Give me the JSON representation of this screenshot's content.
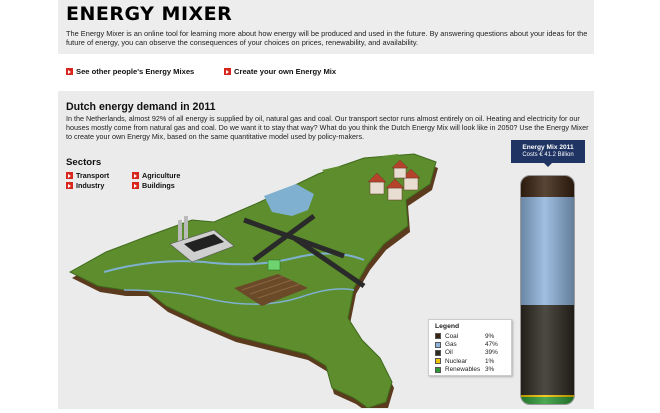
{
  "header": {
    "title": "ENERGY MIXER",
    "intro": "The Energy Mixer is an online tool for learning more about how energy will be produced and used in the future. By answering questions about your ideas for the future of energy, you can observe the consequences of your choices on prices, renewability, and availability."
  },
  "links": {
    "see_others": "See other people's Energy Mixes",
    "create_own": "Create your own Energy Mix"
  },
  "panel": {
    "heading": "Dutch energy demand in 2011",
    "description": "In the Netherlands, almost 92% of all energy is supplied by oil, natural gas and coal. Our transport sector runs almost entirely on oil. Heating and electricity for our houses mostly come from natural gas and coal. Do we want it to stay that way? What do you think the Dutch Energy Mix will look like in 2050? Use the Energy Mixer to create your own Energy Mix, based on the same quantitative model used by policy-makers."
  },
  "sectors": {
    "heading": "Sectors",
    "items": [
      "Transport",
      "Agriculture",
      "Industry",
      "Buildings"
    ]
  },
  "mix": {
    "title": "Energy Mix 2011",
    "cost": "Costs € 41.2 Billion"
  },
  "legend": {
    "title": "Legend",
    "items": [
      {
        "name": "Coal",
        "value": "9%",
        "fraction": 0.09,
        "color": "#3a2412"
      },
      {
        "name": "Gas",
        "value": "47%",
        "fraction": 0.47,
        "color": "#8fb4dc"
      },
      {
        "name": "Oil",
        "value": "39%",
        "fraction": 0.39,
        "color": "#2e2a22"
      },
      {
        "name": "Nuclear",
        "value": "1%",
        "fraction": 0.01,
        "color": "#f2c400"
      },
      {
        "name": "Renewables",
        "value": "3%",
        "fraction": 0.03,
        "color": "#2e9a36"
      }
    ]
  },
  "colors": {
    "accent_red": "#d9261c",
    "mix_box_navy": "#1f3463",
    "map_green": "#5d8d2c"
  }
}
